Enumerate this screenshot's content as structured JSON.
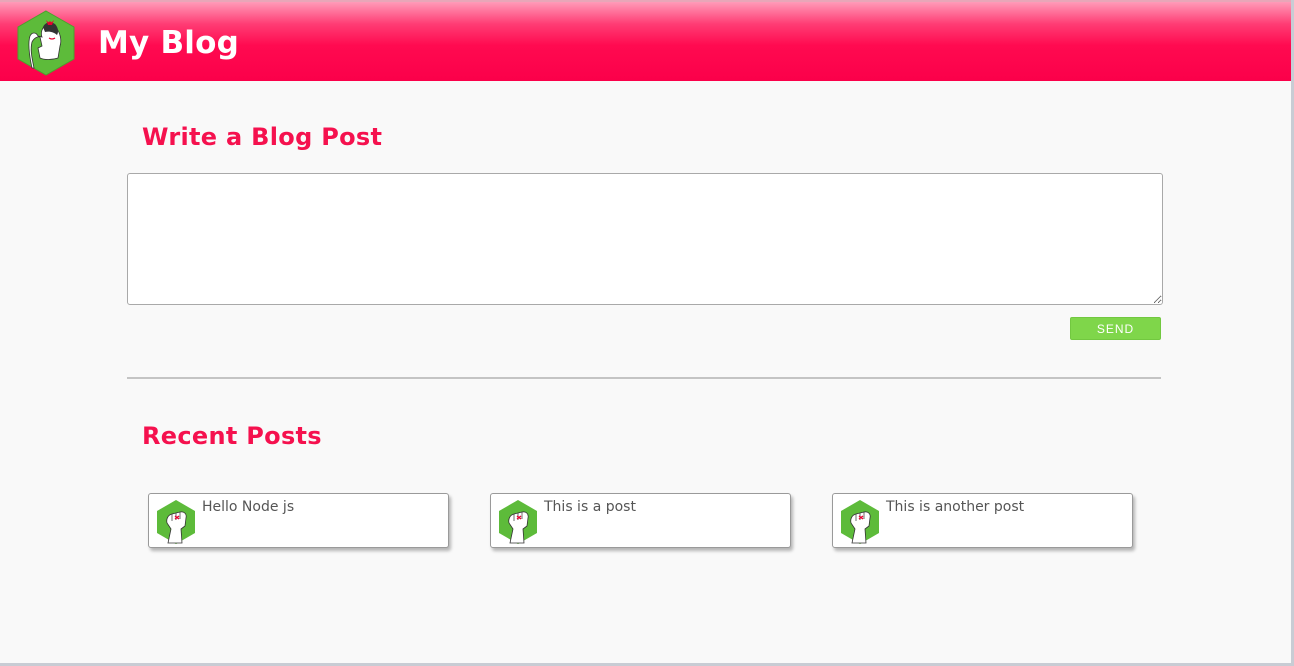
{
  "header": {
    "title": "My Blog",
    "logo_icon": "pinup-girl-hexagon-icon",
    "gradient_top": "#ff9bb8",
    "gradient_bottom": "#fb004a"
  },
  "compose": {
    "heading": "Write a Blog Post",
    "textarea_value": "",
    "send_label": "SEND",
    "send_color": "#7fd64a"
  },
  "recent": {
    "heading": "Recent Posts",
    "posts": [
      {
        "text": "Hello Node js",
        "avatar_icon": "fist-hexagon-icon"
      },
      {
        "text": "This is a post",
        "avatar_icon": "fist-hexagon-icon"
      },
      {
        "text": "This is another post",
        "avatar_icon": "fist-hexagon-icon"
      }
    ]
  },
  "colors": {
    "accent": "#f5114e",
    "hexagon_green": "#5dbb3a",
    "background": "#f9f9f9"
  }
}
